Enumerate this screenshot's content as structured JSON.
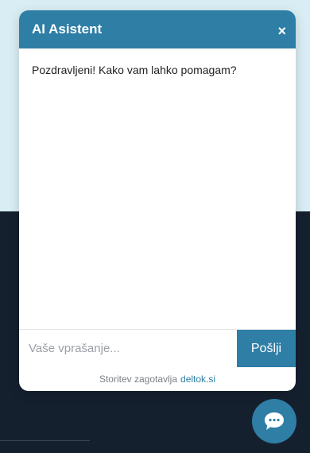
{
  "chat": {
    "title": "AI Asistent",
    "close_label": "×",
    "greeting": "Pozdravljeni! Kako vam lahko pomagam?",
    "input_placeholder": "Vaše vprašanje...",
    "send_label": "Pošlji",
    "footer_text": "Storitev zagotavlja",
    "footer_link": "deltok.si"
  },
  "launcher": {
    "icon": "chat-bubble-icon"
  },
  "colors": {
    "accent": "#2e7ea6",
    "page_top": "#d9eef4",
    "page_bottom": "#15202f"
  }
}
